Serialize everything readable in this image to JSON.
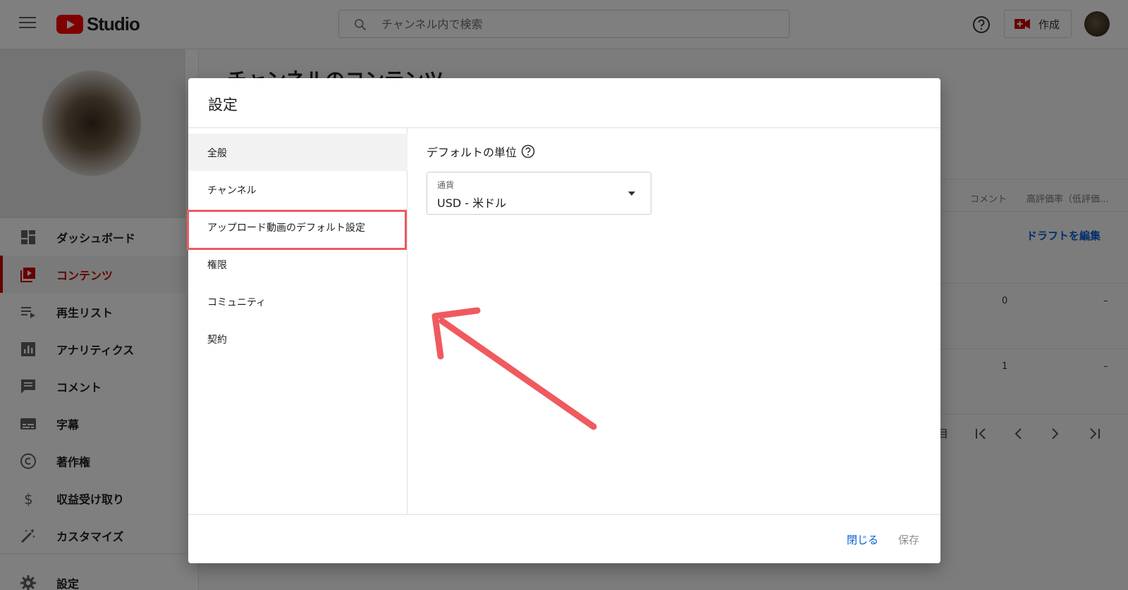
{
  "header": {
    "logo_text": "Studio",
    "search_placeholder": "チャンネル内で検索",
    "create_label": "作成"
  },
  "sidebar": {
    "items": [
      {
        "label": "ダッシュボード",
        "icon": "dashboard-icon"
      },
      {
        "label": "コンテンツ",
        "icon": "content-icon",
        "active": true
      },
      {
        "label": "再生リスト",
        "icon": "playlist-icon"
      },
      {
        "label": "アナリティクス",
        "icon": "analytics-icon"
      },
      {
        "label": "コメント",
        "icon": "comment-icon"
      },
      {
        "label": "字幕",
        "icon": "subtitles-icon"
      },
      {
        "label": "著作権",
        "icon": "copyright-icon"
      },
      {
        "label": "収益受け取り",
        "icon": "dollar-icon"
      },
      {
        "label": "カスタマイズ",
        "icon": "magic-wand-icon"
      },
      {
        "label": "設定",
        "icon": "gear-icon"
      }
    ]
  },
  "background": {
    "page_title": "チャンネルのコンテンツ",
    "col_comments": "コメント",
    "col_rating": "高評価率（低評価...",
    "draft_link": "ドラフトを編集",
    "row1_comments": "0",
    "row1_rating": "–",
    "row2_comments": "1",
    "row2_rating": "–",
    "pager_suffix": "目"
  },
  "dialog": {
    "title": "設定",
    "nav": [
      {
        "label": "全般",
        "selected": true
      },
      {
        "label": "チャンネル"
      },
      {
        "label": "アップロード動画のデフォルト設定"
      },
      {
        "label": "権限"
      },
      {
        "label": "コミュニティ"
      },
      {
        "label": "契約"
      }
    ],
    "section_title": "デフォルトの単位",
    "currency_label": "通貨",
    "currency_value": "USD - 米ドル",
    "close_label": "閉じる",
    "save_label": "保存"
  },
  "colors": {
    "brand_red": "#ff0000",
    "active_red": "#cc0000",
    "highlight": "#ef5a5f",
    "link_blue": "#065fd4"
  }
}
